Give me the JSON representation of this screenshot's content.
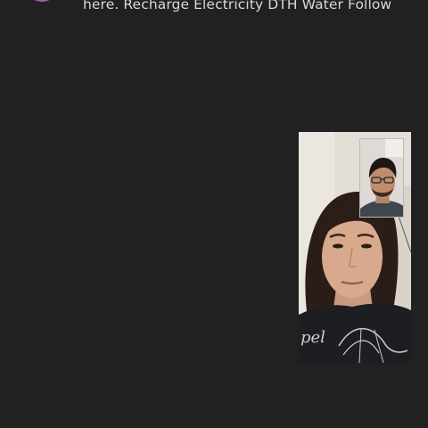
{
  "notification": {
    "text": "here. Recharge Electricity DTH Water Follow",
    "avatar_color": "#9c5fb5"
  },
  "call": {
    "background_color": "#212121",
    "main_video_icon": "remote-participant-video",
    "pip_video_icon": "self-view-video"
  }
}
